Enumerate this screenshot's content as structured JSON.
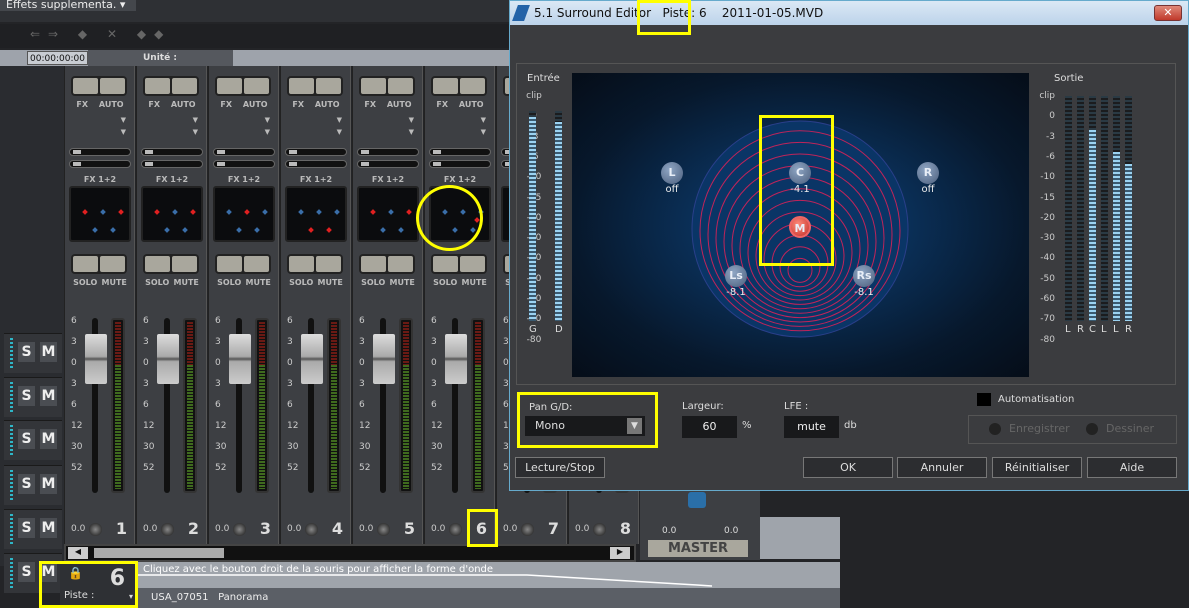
{
  "toolbar": {
    "effects_dropdown": "Effets supplementa.",
    "timecode": "00:00:00:00",
    "unit_label": "Unité :"
  },
  "tracks": {
    "solo": "S",
    "mute": "M"
  },
  "mixer": {
    "fx_label": "FX",
    "auto_label": "AUTO",
    "send_label": "FX 1+2",
    "solo_label": "SOLO",
    "mute_label": "MUTE",
    "fader_scale": [
      "6",
      "3",
      "0",
      "3",
      "6",
      "12",
      "30",
      "52"
    ],
    "channels": [
      {
        "number": "1",
        "value": "0.0",
        "dots": [
          "r",
          "b",
          "r",
          "b",
          "b"
        ]
      },
      {
        "number": "2",
        "value": "0.0",
        "dots": [
          "r",
          "b",
          "r",
          "b",
          "b"
        ]
      },
      {
        "number": "3",
        "value": "0.0",
        "dots": [
          "b",
          "r",
          "b",
          "b",
          "b"
        ]
      },
      {
        "number": "4",
        "value": "0.0",
        "dots": [
          "b",
          "b",
          "b",
          "r",
          "r"
        ]
      },
      {
        "number": "5",
        "value": "0.0",
        "dots": [
          "r",
          "b",
          "r",
          "b",
          "b"
        ]
      },
      {
        "number": "6",
        "value": "0.0",
        "dots": [
          "b",
          "b",
          "b",
          "b",
          "b",
          "r"
        ]
      },
      {
        "number": "7",
        "value": "0.0",
        "dots": []
      },
      {
        "number": "8",
        "value": "0.0",
        "dots": []
      }
    ],
    "master": {
      "label": "MASTER",
      "left": "0.0",
      "right": "0.0"
    }
  },
  "track_lane": {
    "hint": "Cliquez avec le bouton droit de la souris pour afficher la forme d'onde",
    "clip_name": "USA_07051",
    "clip_effect": "Panorama",
    "piste_label": "Piste :",
    "piste_number": "6"
  },
  "dialog": {
    "title": "5.1 Surround Editor",
    "piste": "Piste: 6",
    "file": "2011-01-05.MVD",
    "close": "✕",
    "input_label": "Entrée",
    "output_label": "Sortie",
    "scale": [
      "clip",
      "0",
      "-3",
      "-6",
      "-10",
      "-15",
      "-20",
      "-30",
      "-40",
      "-50",
      "-60",
      "-70",
      "-80"
    ],
    "input_channels": [
      "G",
      "D"
    ],
    "input_levels": [
      0.97,
      0.95
    ],
    "output_channels": [
      "L",
      "R",
      "C",
      "L",
      "L",
      "R"
    ],
    "output_levels": [
      0,
      0,
      0.85,
      0,
      0.75,
      0.7
    ],
    "speakers": {
      "L": {
        "label": "L",
        "value": "off"
      },
      "C": {
        "label": "C",
        "value": "-4.1"
      },
      "R": {
        "label": "R",
        "value": "off"
      },
      "M": {
        "label": "M"
      },
      "Ls": {
        "label": "Ls",
        "value": "-8.1"
      },
      "Rs": {
        "label": "Rs",
        "value": "-8.1"
      }
    },
    "pan_label": "Pan G/D:",
    "pan_value": "Mono",
    "width_label": "Largeur:",
    "width_value": "60",
    "width_unit": "%",
    "lfe_label": "LFE :",
    "lfe_value": "mute",
    "lfe_unit": "db",
    "automation_label": "Automatisation",
    "record_label": "Enregistrer",
    "draw_label": "Dessiner",
    "play_stop": "Lecture/Stop",
    "ok": "OK",
    "cancel": "Annuler",
    "reset": "Réinitialiser",
    "help": "Aide"
  }
}
